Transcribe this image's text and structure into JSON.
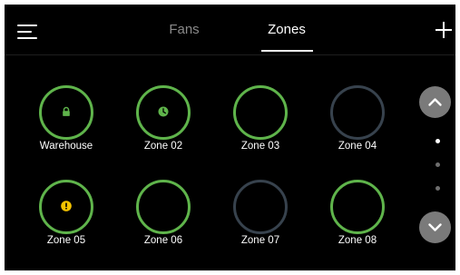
{
  "header": {
    "tabs": [
      {
        "label": "Fans",
        "active": false
      },
      {
        "label": "Zones",
        "active": true
      }
    ],
    "menu_icon": "hamburger-menu-icon",
    "add_icon": "plus-icon"
  },
  "zones": [
    {
      "label": "Warehouse",
      "active": true,
      "icon": "lock-icon"
    },
    {
      "label": "Zone 02",
      "active": true,
      "icon": "clock-icon"
    },
    {
      "label": "Zone 03",
      "active": true,
      "icon": null
    },
    {
      "label": "Zone 04",
      "active": false,
      "icon": null
    },
    {
      "label": "Zone 05",
      "active": true,
      "icon": "warning-icon"
    },
    {
      "label": "Zone 06",
      "active": true,
      "icon": null
    },
    {
      "label": "Zone 07",
      "active": false,
      "icon": null
    },
    {
      "label": "Zone 08",
      "active": true,
      "icon": null
    }
  ],
  "pagination": {
    "pages": 3,
    "current": 1,
    "up_icon": "chevron-up-icon",
    "down_icon": "chevron-down-icon"
  },
  "colors": {
    "background": "#000000",
    "active_ring": "#5fb44b",
    "inactive_ring": "#37424d",
    "warning": "#f5c400",
    "scroll_button": "#7a7a7a"
  }
}
